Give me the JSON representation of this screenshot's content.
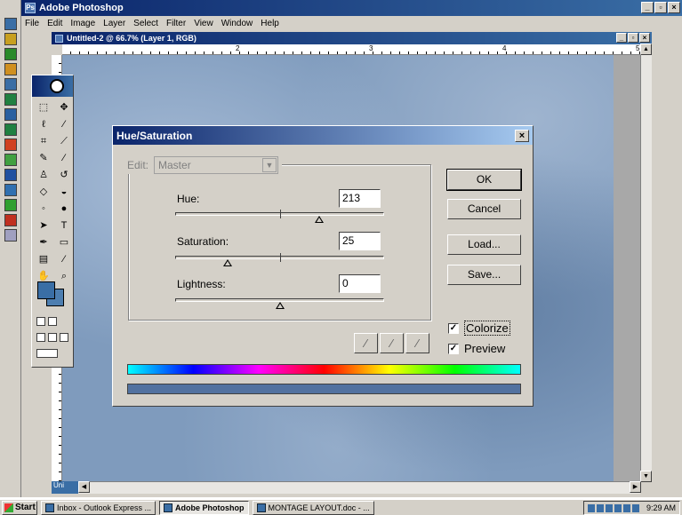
{
  "app": {
    "title": "Adobe Photoshop",
    "menu": [
      "File",
      "Edit",
      "Image",
      "Layer",
      "Select",
      "Filter",
      "View",
      "Window",
      "Help"
    ]
  },
  "document": {
    "title": "Untitled-2 @ 66.7% (Layer 1, RGB)",
    "ruler_marks": [
      "2",
      "3",
      "4",
      "5"
    ],
    "status_tab": "Uni"
  },
  "dialog": {
    "title": "Hue/Saturation",
    "edit_label": "Edit:",
    "edit_value": "Master",
    "hue": {
      "label": "Hue:",
      "value": "213",
      "slider_fraction": 0.69
    },
    "saturation": {
      "label": "Saturation:",
      "value": "25",
      "slider_fraction": 0.25
    },
    "lightness": {
      "label": "Lightness:",
      "value": "0",
      "slider_fraction": 0.5
    },
    "buttons": {
      "ok": "OK",
      "cancel": "Cancel",
      "load": "Load...",
      "save": "Save..."
    },
    "colorize": {
      "label": "Colorize",
      "checked": true
    },
    "preview": {
      "label": "Preview",
      "checked": true
    },
    "result_color": "#5272a0"
  },
  "taskbar": {
    "start": "Start",
    "tasks": [
      {
        "label": "Inbox - Outlook Express ...",
        "active": false
      },
      {
        "label": "Adobe Photoshop",
        "active": true
      },
      {
        "label": "MONTAGE LAYOUT.doc - ...",
        "active": false
      }
    ],
    "clock": "9:29 AM"
  }
}
